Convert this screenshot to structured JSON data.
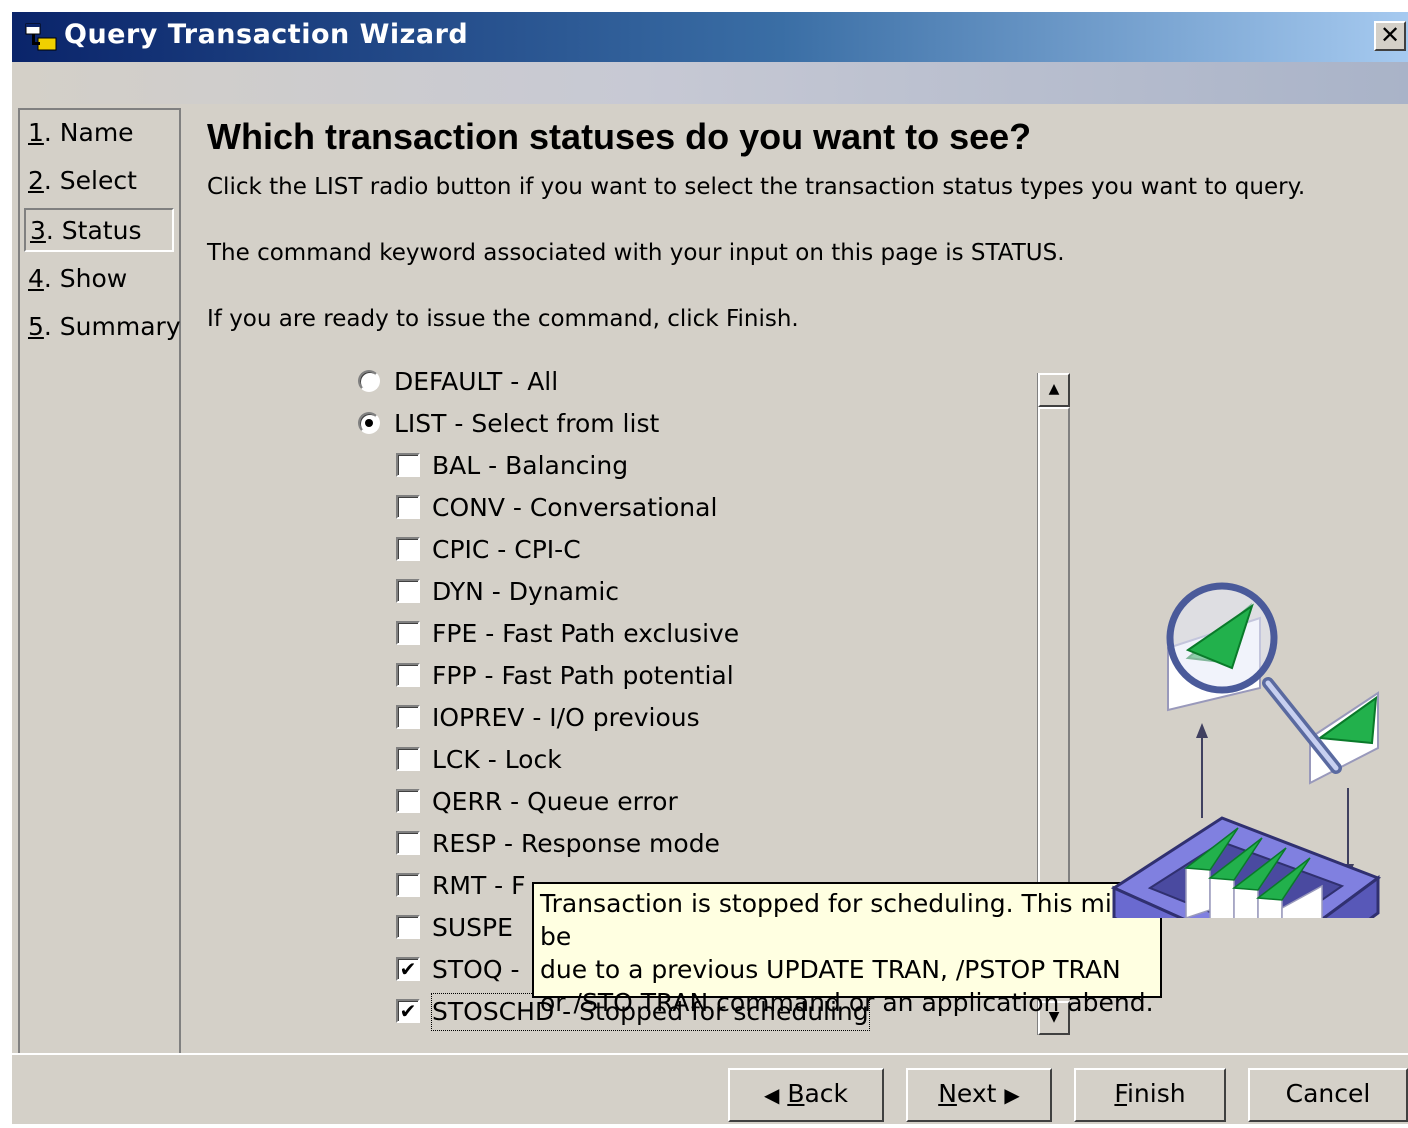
{
  "window": {
    "title": "Query Transaction Wizard",
    "close_label": "✕"
  },
  "steps": [
    {
      "num": "1",
      "label": ". Name"
    },
    {
      "num": "2",
      "label": ". Select"
    },
    {
      "num": "3",
      "label": ". Status",
      "current": true
    },
    {
      "num": "4",
      "label": ". Show"
    },
    {
      "num": "5",
      "label": ". Summary"
    }
  ],
  "content": {
    "heading": "Which transaction statuses do you want to see?",
    "para1": "Click the LIST radio button if you want to select the transaction status types you want to query.",
    "para2": "The command keyword associated with your input on this page is STATUS.",
    "para3": "If you are ready to issue the command, click Finish."
  },
  "options": {
    "radios": [
      {
        "label": "DEFAULT - All",
        "selected": false
      },
      {
        "label": "LIST - Select from list",
        "selected": true
      }
    ],
    "checkboxes": [
      {
        "label": "BAL - Balancing",
        "checked": false
      },
      {
        "label": "CONV - Conversational",
        "checked": false
      },
      {
        "label": "CPIC - CPI-C",
        "checked": false
      },
      {
        "label": "DYN - Dynamic",
        "checked": false
      },
      {
        "label": "FPE - Fast Path exclusive",
        "checked": false
      },
      {
        "label": "FPP - Fast Path potential",
        "checked": false
      },
      {
        "label": "IOPREV - I/O previous",
        "checked": false
      },
      {
        "label": "LCK - Lock",
        "checked": false
      },
      {
        "label": "QERR - Queue error",
        "checked": false
      },
      {
        "label": "RESP - Response mode",
        "checked": false
      },
      {
        "label": "RMT - F",
        "checked": false
      },
      {
        "label": "SUSPE",
        "checked": false
      },
      {
        "label": "STOQ -",
        "checked": true
      },
      {
        "label": "STOSCHD - Stopped for scheduling",
        "checked": true
      }
    ],
    "check_mark": "✔"
  },
  "tooltip": {
    "text": "Transaction is stopped for scheduling. This might be\ndue to a previous UPDATE TRAN, /PSTOP TRAN\nor /STO TRAN command or an application abend."
  },
  "scrollbar": {
    "up": "▲",
    "down": "▼"
  },
  "buttons": {
    "back": {
      "arrow": "◀",
      "mnemonic": "B",
      "rest": "ack"
    },
    "next": {
      "mnemonic": "N",
      "rest": "ext",
      "arrow": "▶"
    },
    "finish": {
      "mnemonic": "F",
      "rest": "inish"
    },
    "cancel": {
      "label": "Cancel"
    }
  },
  "colors": {
    "title_start": "#0a246a",
    "title_end": "#a6caf0",
    "face": "#d4d0c8",
    "tooltip_bg": "#ffffe1",
    "envelope_green": "#22b14c",
    "tray_purple": "#8080e0"
  }
}
